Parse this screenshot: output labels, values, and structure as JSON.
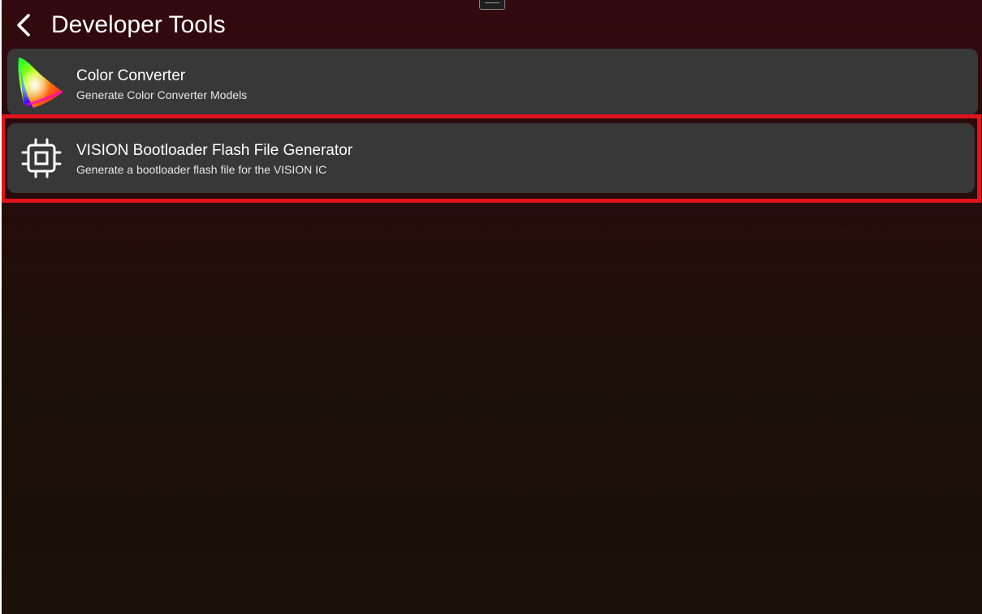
{
  "header": {
    "back_icon": "chevron-left-icon",
    "title": "Developer Tools"
  },
  "tools": [
    {
      "title": "Color Converter",
      "description": "Generate Color Converter Models",
      "icon": "color-gamut-icon"
    },
    {
      "title": "VISION Bootloader Flash File Generator",
      "description": "Generate a bootloader flash file for the VISION IC",
      "icon": "chip-icon"
    }
  ],
  "colors": {
    "background_top": "#330a0f",
    "background_bottom": "#1a1108",
    "card": "#383838",
    "highlight": "#e0141b"
  }
}
